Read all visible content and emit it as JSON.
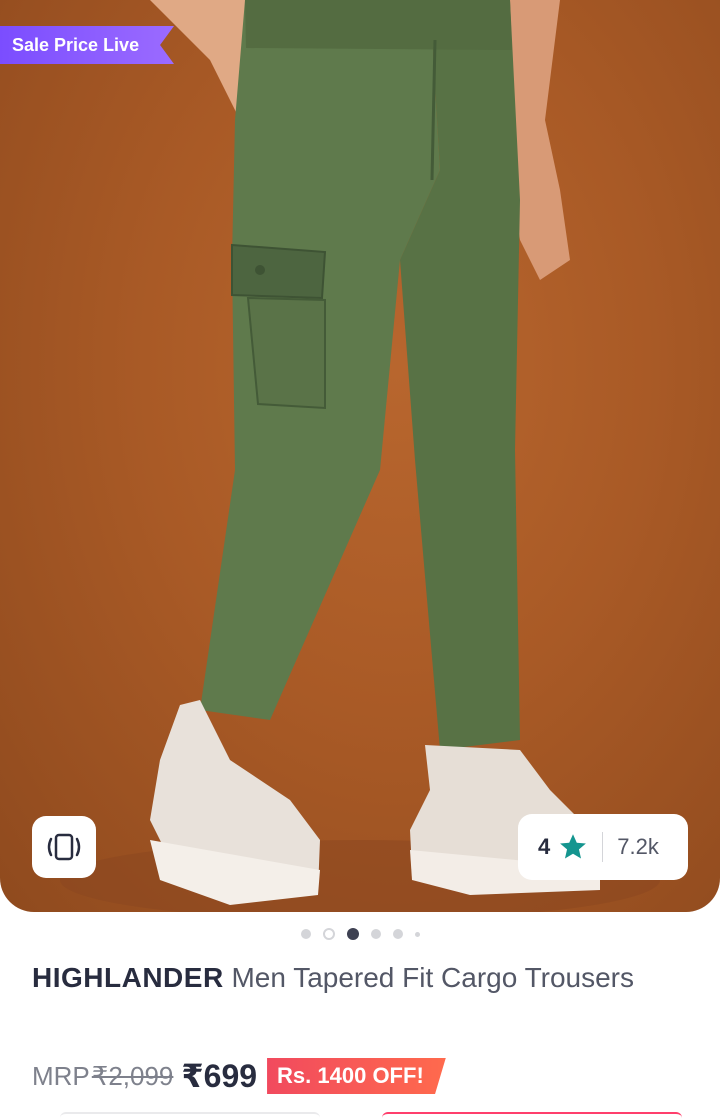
{
  "hero": {
    "sale_badge": "Sale Price Live",
    "view_icon": "rotate-view-icon",
    "rating": {
      "value": "4",
      "star_icon": "star-icon",
      "count": "7.2k"
    },
    "accent_star_color": "#14958f"
  },
  "carousel": {
    "total": 6,
    "active_index": 2
  },
  "product": {
    "brand": "HIGHLANDER",
    "name": " Men Tapered Fit Cargo Trousers"
  },
  "pricing": {
    "mrp_label": "MRP",
    "mrp": "₹2,099",
    "price": "₹699",
    "discount": "Rs. 1400 OFF!",
    "discount_color": "#f14a5e"
  }
}
